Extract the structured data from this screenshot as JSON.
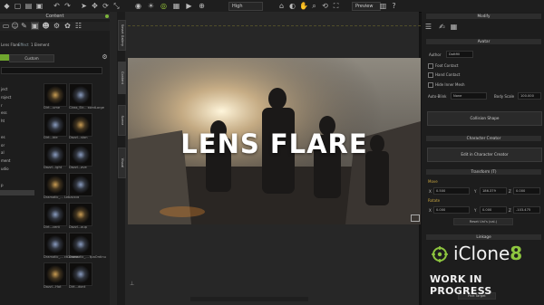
{
  "toolbar": {
    "quality": "High",
    "view_mode": "Preview"
  },
  "left_panel": {
    "title": "Content",
    "filter_label": "Lens Flare",
    "filter_name": "Effect",
    "filter_value": "1 Element",
    "tab_custom": "Custom",
    "tree": [
      "ject",
      "roject",
      "r",
      "ess",
      "ht",
      "",
      "es",
      "or",
      "al",
      "ment",
      "udio",
      "",
      "p"
    ],
    "thumbs": [
      {
        "label": "Dirt...ume"
      },
      {
        "label": "Class_Str... ssedLarge"
      },
      {
        "label": "Dirt...ble"
      },
      {
        "label": "Dazzl...sion"
      },
      {
        "label": "Dazzl...ight"
      },
      {
        "label": "Dazzl...ave"
      },
      {
        "label": "Dramatic_... LeBacklit"
      },
      {
        "label": ""
      },
      {
        "label": "Dirt...cent"
      },
      {
        "label": "Dazzl...oup"
      },
      {
        "label": "Dramatic_... ctDrama"
      },
      {
        "label": "Dramatic_... tpaOrdinu"
      },
      {
        "label": "Dazzl...Hot"
      },
      {
        "label": "Dirt...dont"
      }
    ]
  },
  "side_tabs": [
    "Smart Gallery",
    "Content",
    "Scene",
    "Visual"
  ],
  "viewport": {
    "title": "LENS FLARE"
  },
  "right_panel": {
    "title": "Modify",
    "section_avatar": "Avatar",
    "author_label": "Author",
    "author_value": "Dottfill",
    "opt1": "Foot Contact",
    "opt2": "Hand Contact",
    "opt3": "Hide Inner Mesh",
    "autoblink_label": "Auto-Blink",
    "autoblink_value": "None",
    "bodyscale_label": "Body Scale",
    "bodyscale_value": "100.000",
    "collision_btn": "Collision Shape",
    "section_character": "Character Creator",
    "edit_btn": "Edit in Character Creator",
    "section_transform": "Transform (T)",
    "move_label": "Move",
    "move_x_label": "X",
    "move_x": "0.500",
    "move_y_label": "Y",
    "move_y": "186.379",
    "move_z_label": "Z",
    "move_z": "0.000",
    "rotate_label": "Rotate",
    "rot_x_label": "X",
    "rot_x": "0.000",
    "rot_y_label": "Y",
    "rot_y": "0.000",
    "rot_z_label": "Z",
    "rot_z": "-103.475",
    "reset_btn": "Reset Uni's (cal.)",
    "section_linkage": "Linkage",
    "pick_target": "Pick Target"
  },
  "branding": {
    "product": "iClone",
    "version": "8",
    "banner": "WORK IN PROGRESS"
  }
}
